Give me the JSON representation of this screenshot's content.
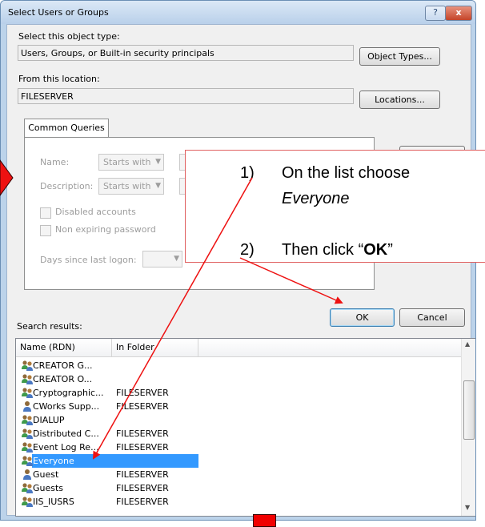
{
  "window": {
    "title": "Select Users or Groups",
    "help_glyph": "?",
    "close_glyph": "x"
  },
  "object_type": {
    "label": "Select this object type:",
    "value": "Users, Groups, or Built-in security principals",
    "button": "Object Types..."
  },
  "location": {
    "label": "From this location:",
    "value": "FILESERVER",
    "button": "Locations..."
  },
  "queries": {
    "tab": "Common Queries",
    "name_label": "Name:",
    "name_mode": "Starts with",
    "desc_label": "Description:",
    "desc_mode": "Starts with",
    "disabled_accounts": "Disabled accounts",
    "non_expiring": "Non expiring password",
    "days_label": "Days since last logon:"
  },
  "actions": {
    "ok": "OK",
    "cancel": "Cancel"
  },
  "results": {
    "label": "Search results:",
    "col_name": "Name (RDN)",
    "col_folder": "In Folder",
    "rows": [
      {
        "name": "CREATOR G...",
        "folder": "",
        "icon": "group-icon"
      },
      {
        "name": "CREATOR O...",
        "folder": "",
        "icon": "group-icon"
      },
      {
        "name": "Cryptographic...",
        "folder": "FILESERVER",
        "icon": "group-icon"
      },
      {
        "name": "CWorks Supp...",
        "folder": "FILESERVER",
        "icon": "user-icon"
      },
      {
        "name": "DIALUP",
        "folder": "",
        "icon": "group-icon"
      },
      {
        "name": "Distributed C...",
        "folder": "FILESERVER",
        "icon": "group-icon"
      },
      {
        "name": "Event Log Re...",
        "folder": "FILESERVER",
        "icon": "group-icon"
      },
      {
        "name": "Everyone",
        "folder": "",
        "icon": "group-icon",
        "selected": true
      },
      {
        "name": "Guest",
        "folder": "FILESERVER",
        "icon": "user-icon"
      },
      {
        "name": "Guests",
        "folder": "FILESERVER",
        "icon": "group-icon"
      },
      {
        "name": "IIS_IUSRS",
        "folder": "FILESERVER",
        "icon": "group-icon"
      }
    ]
  },
  "annotation": {
    "step1_num": "1)",
    "step1_line1": "On the list choose",
    "step1_line2": "Everyone",
    "step2_num": "2)",
    "step2_prefix": "Then click “",
    "step2_bold": "OK",
    "step2_suffix": "”"
  },
  "colors": {
    "arrow": "#ee1111",
    "selection": "#3399ff"
  }
}
